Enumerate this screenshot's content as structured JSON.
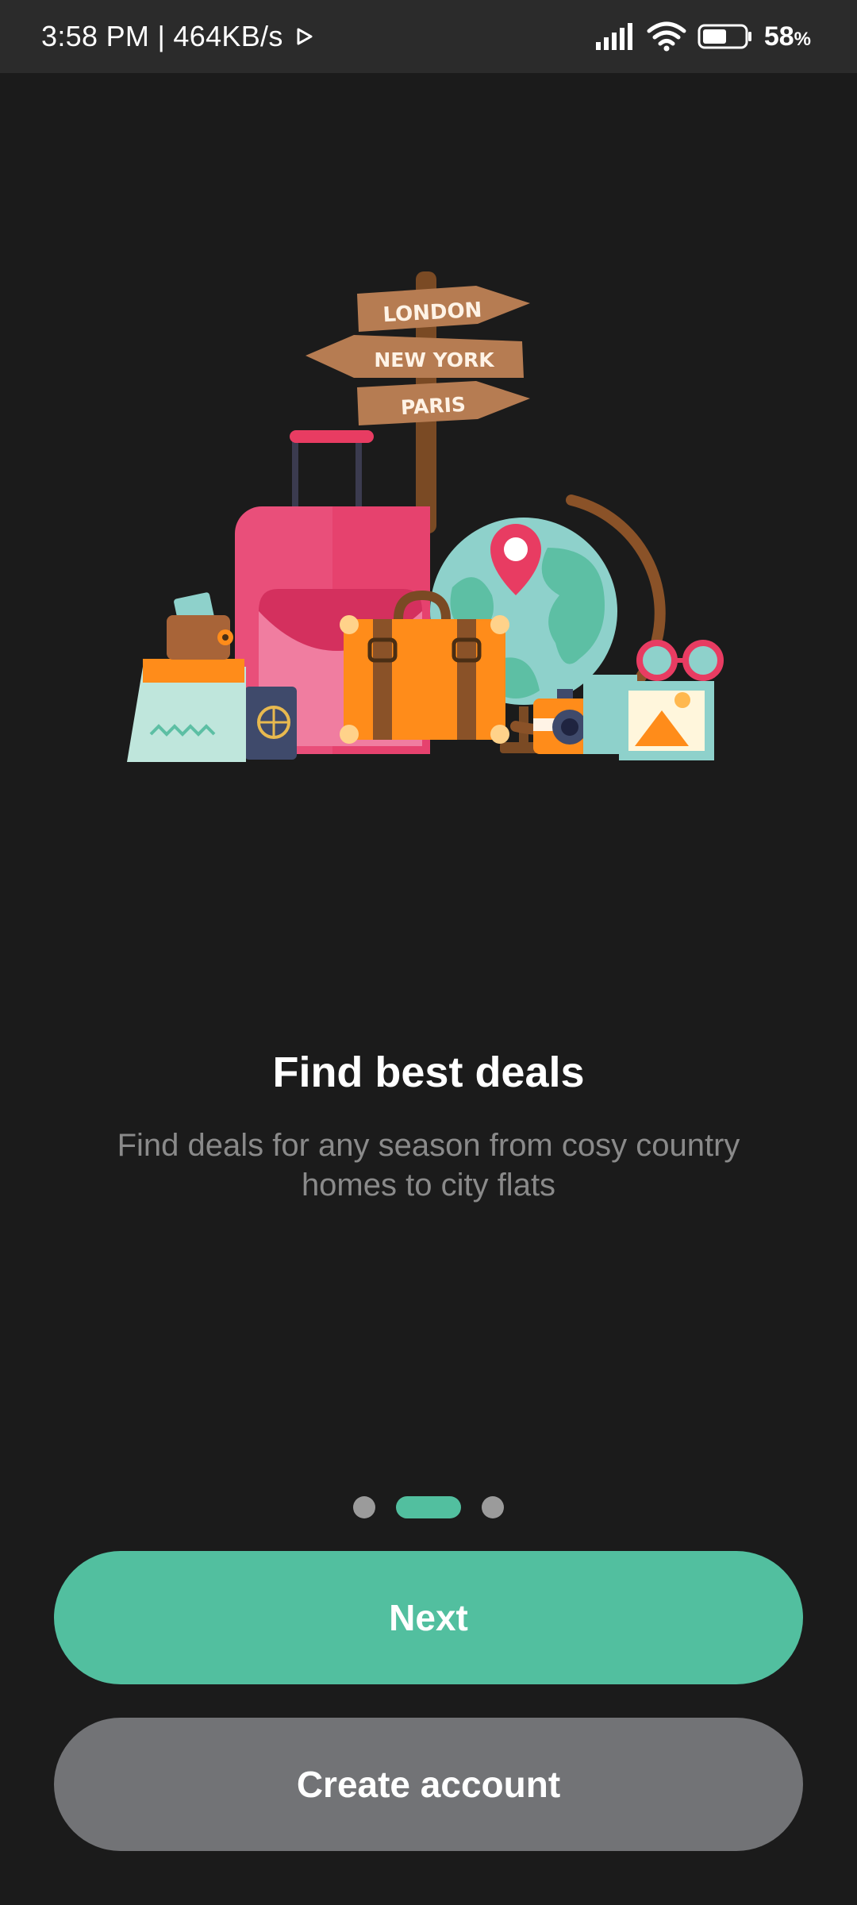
{
  "status_bar": {
    "time_speed": "3:58 PM | 464KB/s",
    "battery_level": "58",
    "battery_unit": "%",
    "battery_fill_fraction": 0.58,
    "icons": [
      "play-store-icon",
      "signal-icon",
      "wifi-icon",
      "battery-icon"
    ]
  },
  "illustration": {
    "signs": [
      "LONDON",
      "NEW YORK",
      "PARIS"
    ]
  },
  "onboarding": {
    "title": "Find best deals",
    "subtitle": "Find deals for any season from cosy country homes to city flats",
    "page_count": 3,
    "active_page": 2
  },
  "actions": {
    "next_label": "Next",
    "create_account_label": "Create account"
  },
  "colors": {
    "background": "#1b1b1b",
    "accent": "#52bf9f",
    "secondary_button": "#727376"
  }
}
